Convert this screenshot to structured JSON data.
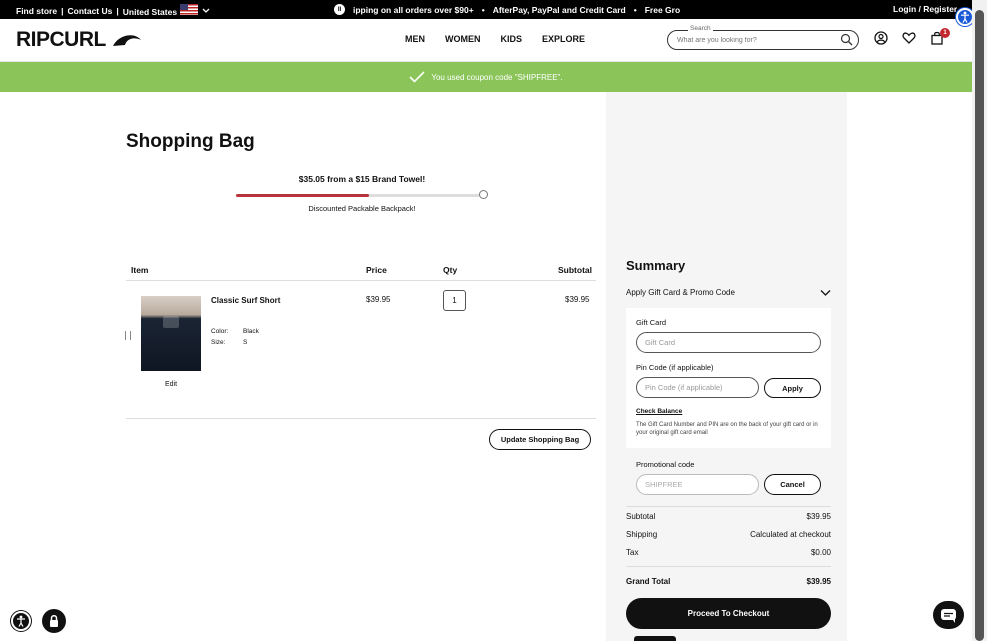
{
  "topbar": {
    "find_store": "Find store",
    "contact": "Contact Us",
    "country": "United States",
    "promo_1": "ipping on all orders over $90+",
    "promo_2": "AfterPay, PayPal and Credit Card",
    "promo_3": "Free Gro",
    "login": "Login / Register"
  },
  "header": {
    "logo": "RIPCURL",
    "nav": [
      "MEN",
      "WOMEN",
      "KIDS",
      "EXPLORE"
    ],
    "search_label": "Search",
    "search_placeholder": "What are you looking for?",
    "cart_count": "1"
  },
  "banner": {
    "message": "You used coupon code \"SHIPFREE\"."
  },
  "page": {
    "title": "Shopping Bag"
  },
  "reward": {
    "headline": "$35.05 from a $15 Brand Towel!",
    "progress": 0.54,
    "subtext": "Discounted Packable Backpack!"
  },
  "table": {
    "headers": {
      "item": "Item",
      "price": "Price",
      "qty": "Qty",
      "subtotal": "Subtotal"
    },
    "rows": [
      {
        "name": "Classic Surf Short",
        "color_label": "Color:",
        "color": "Black",
        "size_label": "Size:",
        "size": "S",
        "edit": "Edit",
        "price": "$39.95",
        "qty": "1",
        "subtotal": "$39.95"
      }
    ]
  },
  "update_button": "Update Shopping Bag",
  "summary": {
    "title": "Summary",
    "accordion": "Apply Gift Card & Promo Code",
    "gift_card_label": "Gift Card",
    "gift_card_placeholder": "Gift Card",
    "pin_label": "Pin Code (if applicable)",
    "pin_placeholder": "Pin Code (if applicable)",
    "apply": "Apply",
    "check_balance": "Check Balance",
    "note": "The Gift Card Number and PIN are on the back of your gift card or in your original gift card email",
    "promo_label": "Promotional code",
    "promo_value": "SHIPFREE",
    "cancel": "Cancel",
    "subtotal_label": "Subtotal",
    "subtotal": "$39.95",
    "shipping_label": "Shipping",
    "shipping": "Calculated at checkout",
    "tax_label": "Tax",
    "tax": "$0.00",
    "grand_label": "Grand Total",
    "grand": "$39.95",
    "checkout": "Proceed To Checkout"
  },
  "colors": {
    "banner": "#8bc559",
    "progress": "#b9333b",
    "accessibility": "#1a5ad7"
  }
}
